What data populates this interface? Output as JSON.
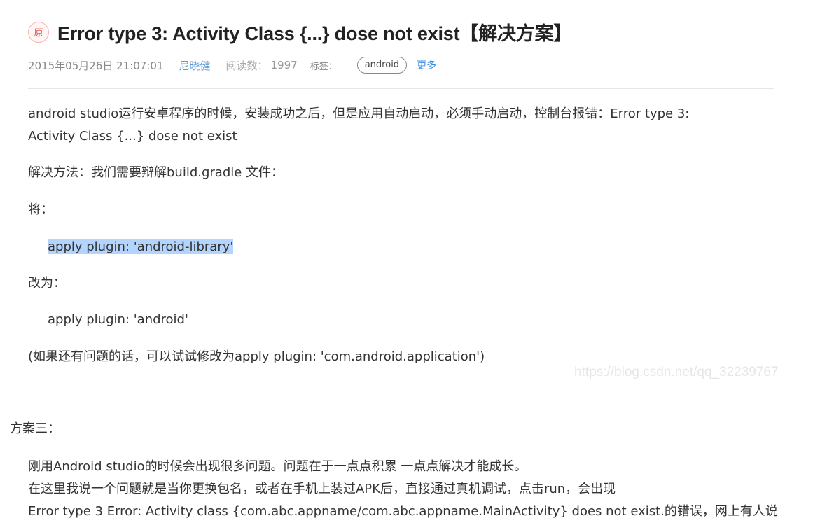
{
  "article": {
    "badge": "原",
    "title": "Error type 3: Activity Class {...} dose not exist【解决方案】",
    "meta": {
      "date": "2015年05月26日 21:07:01",
      "author": "尼晓健",
      "reads_label": "阅读数：",
      "reads_value": "1997",
      "tags_label": "标签：",
      "tag": "android",
      "more": "更多"
    },
    "body": {
      "p1_line1": "android studio运行安卓程序的时候，安装成功之后，但是应用自动启动，必须手动启动，控制台报错：Error type 3:",
      "p1_line2": "Activity Class {...} dose not exist",
      "p2": "解决方法：我们需要辩解build.gradle 文件：",
      "p3": "将：",
      "code1": "apply plugin: 'android-library'",
      "p4": "改为：",
      "code2": "apply plugin: 'android'",
      "p5": "(如果还有问题的话，可以试试修改为apply plugin: 'com.android.application')"
    },
    "watermark": "https://blog.csdn.net/qq_32239767",
    "section3": {
      "heading": "方案三：",
      "line1": "刚用Android studio的时候会出现很多问题。问题在于一点点积累 一点点解决才能成长。",
      "line2": "在这里我说一个问题就是当你更换包名，或者在手机上装过APK后，直接通过真机调试，点击run，会出现",
      "line3": "Error type 3 Error: Activity class {com.abc.appname/com.abc.appname.MainActivity} does not exist.的错误，网上有人说"
    }
  }
}
